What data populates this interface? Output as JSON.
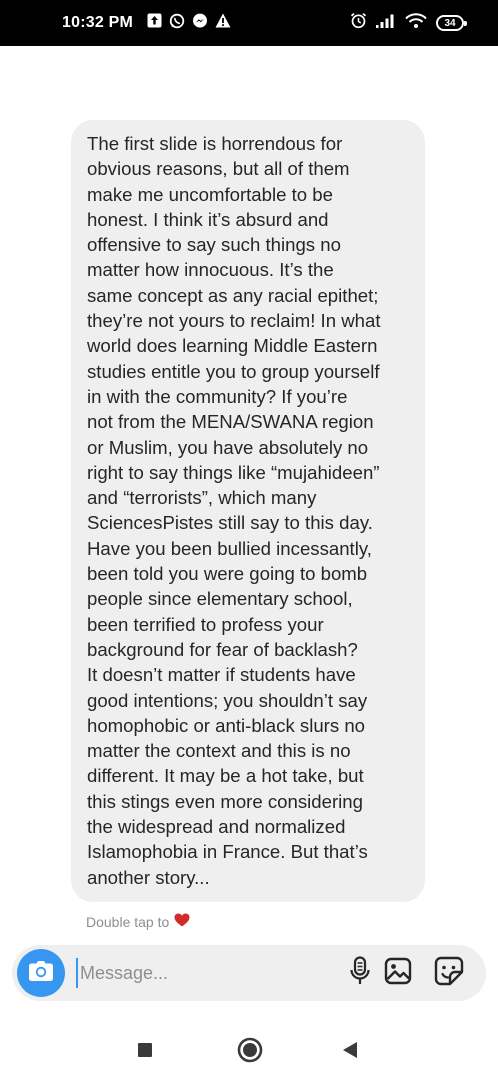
{
  "status_bar": {
    "time": "10:32 PM",
    "left_icons": [
      "upload-box-icon",
      "whatsapp-icon",
      "messenger-icon",
      "warning-icon"
    ],
    "right_icons": [
      "alarm-icon",
      "signal-icon",
      "wifi-icon",
      "battery-icon"
    ],
    "battery_level": "34"
  },
  "conversation": {
    "message_text": "The first slide is horrendous for\nobvious reasons, but all of them\nmake me uncomfortable to be\nhonest. I think it’s absurd and\noffensive to say such things no\nmatter how innocuous. It’s the\nsame concept as any racial epithet;\nthey’re not yours to reclaim! In what\nworld does learning Middle Eastern\nstudies entitle you to group yourself\nin with the community? If you’re\nnot from the MENA/SWANA region\nor Muslim, you have absolutely no\nright to say things like “mujahideen”\nand “terrorists”, which many\nSciencesPistes still say to this day.\nHave you been bullied incessantly,\nbeen told you were going to bomb\npeople since elementary school,\nbeen terrified to profess your\nbackground for fear of backlash?\nIt doesn’t matter if students have\ngood intentions; you shouldn’t say\nhomophobic or anti-black slurs no\nmatter the context and this is no\ndifferent. It may be a hot take, but\nthis stings even more considering\nthe widespread and normalized\nIslamophobia in France. But that’s\nanother story...",
    "double_tap_label": "Double tap to"
  },
  "composer": {
    "placeholder": "Message...",
    "value": "",
    "icons": [
      "camera-icon",
      "microphone-icon",
      "gallery-icon",
      "sticker-icon"
    ]
  },
  "navigation": {
    "buttons": [
      "recents-button",
      "home-button",
      "back-button"
    ]
  },
  "colors": {
    "accent": "#3797f0",
    "bubble": "#efefef",
    "heart": "#d42a2a",
    "status_bar": "#000000"
  }
}
